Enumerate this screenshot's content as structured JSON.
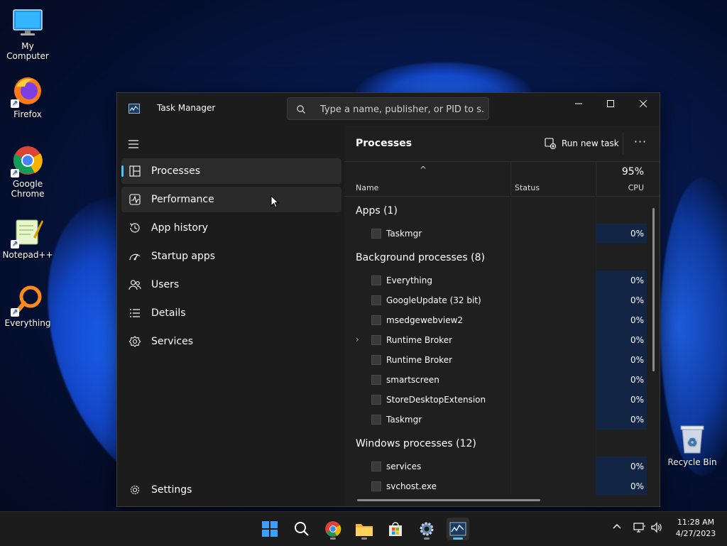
{
  "desktop": {
    "icons": [
      {
        "label": "My Computer"
      },
      {
        "label": "Firefox"
      },
      {
        "label": "Google Chrome"
      },
      {
        "label": "Notepad++"
      },
      {
        "label": "Everything"
      },
      {
        "label": "Recycle Bin"
      }
    ]
  },
  "window": {
    "title": "Task Manager",
    "search_placeholder": "Type a name, publisher, or PID to s..."
  },
  "nav": {
    "items": [
      {
        "label": "Processes",
        "icon": "processes-icon"
      },
      {
        "label": "Performance",
        "icon": "performance-icon"
      },
      {
        "label": "App history",
        "icon": "history-icon"
      },
      {
        "label": "Startup apps",
        "icon": "startup-icon"
      },
      {
        "label": "Users",
        "icon": "users-icon"
      },
      {
        "label": "Details",
        "icon": "details-icon"
      },
      {
        "label": "Services",
        "icon": "services-icon"
      }
    ],
    "settings": "Settings"
  },
  "pane": {
    "title": "Processes",
    "run_new_task": "Run new task",
    "more": "···"
  },
  "columns": {
    "name": "Name",
    "status": "Status",
    "cpu_total": "95%",
    "cpu": "CPU",
    "sort_arrow": "^"
  },
  "groups": {
    "apps": "Apps (1)",
    "background": "Background processes (8)",
    "windows": "Windows processes (12)"
  },
  "apps": [
    {
      "name": "Taskmgr",
      "cpu": "0%"
    }
  ],
  "background": [
    {
      "name": "Everything",
      "cpu": "0%"
    },
    {
      "name": "GoogleUpdate (32 bit)",
      "cpu": "0%"
    },
    {
      "name": "msedgewebview2",
      "cpu": "0%"
    },
    {
      "name": "Runtime Broker",
      "cpu": "0%",
      "expandable": true
    },
    {
      "name": "Runtime Broker",
      "cpu": "0%"
    },
    {
      "name": "smartscreen",
      "cpu": "0%"
    },
    {
      "name": "StoreDesktopExtension",
      "cpu": "0%"
    },
    {
      "name": "Taskmgr",
      "cpu": "0%"
    }
  ],
  "windows_procs": [
    {
      "name": "services",
      "cpu": "0%"
    },
    {
      "name": "svchost.exe",
      "cpu": "0%"
    }
  ],
  "taskbar": {
    "time": "11:28 AM",
    "date": "4/27/2023"
  },
  "colors": {
    "accent": "#4cc2ff",
    "cpu_cell": "#132544"
  }
}
